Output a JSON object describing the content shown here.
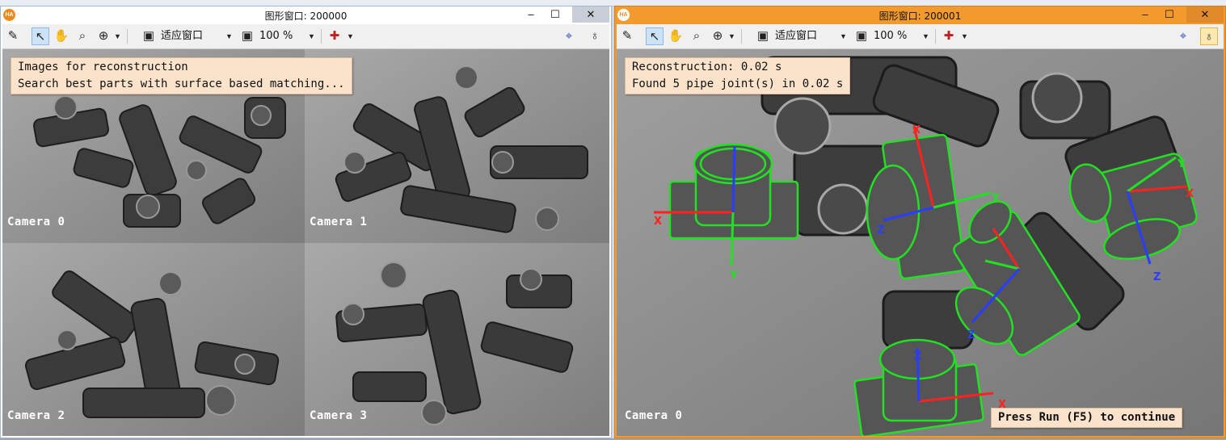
{
  "left_window": {
    "title": "图形窗口: 200000",
    "app_icon": "HA",
    "controls": {
      "minimize": "–",
      "maximize": "☐",
      "close": "✕"
    },
    "toolbar": {
      "fit_label": "适应窗口",
      "zoom_label": "100 %"
    },
    "message_lines": [
      "Images for reconstruction",
      "Search best parts with surface based matching..."
    ],
    "cameras": [
      "Camera 0",
      "Camera 1",
      "Camera 2",
      "Camera 3"
    ]
  },
  "right_window": {
    "title": "图形窗口: 200001",
    "app_icon": "HA",
    "controls": {
      "minimize": "–",
      "maximize": "☐",
      "close": "✕"
    },
    "toolbar": {
      "fit_label": "适应窗口",
      "zoom_label": "100 %"
    },
    "message_lines": [
      "Reconstruction: 0.02 s",
      "Found 5 pipe joint(s) in 0.02 s"
    ],
    "camera_label": "Camera 0",
    "continue_prompt": "Press Run (F5) to continue",
    "axis_labels": {
      "x": "X",
      "y": "Y",
      "z": "Z"
    }
  },
  "colors": {
    "accent_orange": "#f39a2e",
    "match_green": "#22e022",
    "axis_x": "#ff2020",
    "axis_y": "#22e022",
    "axis_z": "#2a3cff"
  },
  "icons": [
    "edit-icon",
    "pointer-icon",
    "hand-pan-icon",
    "magnifier-icon",
    "zoom-in-icon",
    "fit-window-icon",
    "zoom-percent-icon",
    "color-palette-icon",
    "pin-marker-icon",
    "lightbulb-icon"
  ]
}
